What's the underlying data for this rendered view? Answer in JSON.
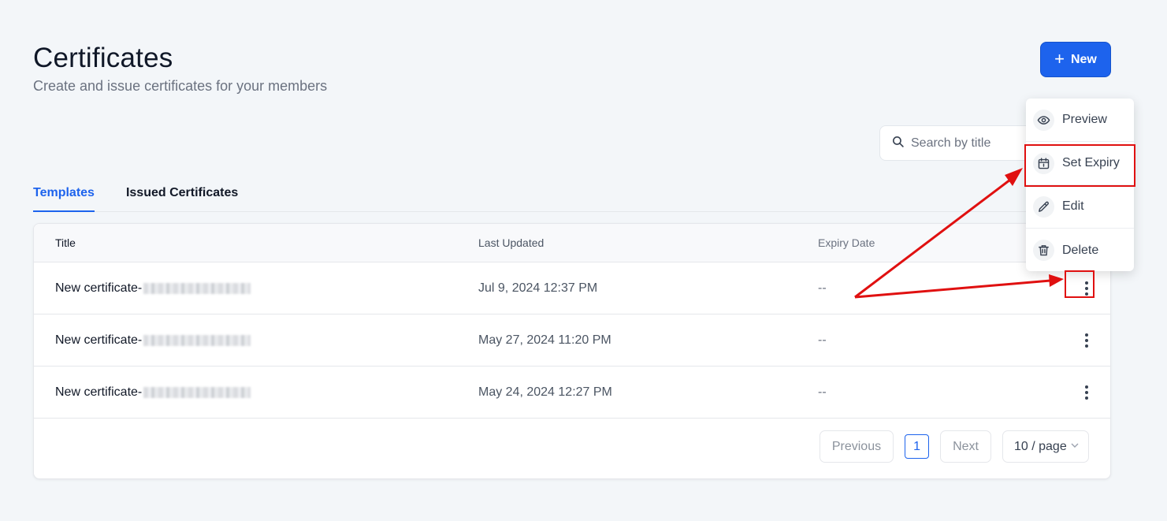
{
  "header": {
    "title": "Certificates",
    "subtitle": "Create and issue certificates for your members",
    "new_button_label": "New"
  },
  "search": {
    "placeholder": "Search by title"
  },
  "tabs": [
    {
      "label": "Templates",
      "active": true
    },
    {
      "label": "Issued Certificates",
      "active": false
    }
  ],
  "table": {
    "columns": [
      "Title",
      "Last Updated",
      "Expiry Date"
    ],
    "rows": [
      {
        "title": "New certificate-",
        "last_updated": "Jul 9, 2024 12:37 PM",
        "expiry": "--"
      },
      {
        "title": "New certificate-",
        "last_updated": "May 27, 2024 11:20 PM",
        "expiry": "--"
      },
      {
        "title": "New certificate-",
        "last_updated": "May 24, 2024 12:27 PM",
        "expiry": "--"
      }
    ]
  },
  "pagination": {
    "previous_label": "Previous",
    "current_page": "1",
    "next_label": "Next",
    "page_size": "10 / page"
  },
  "context_menu": {
    "items": [
      {
        "label": "Preview",
        "icon": "eye-icon"
      },
      {
        "label": "Set Expiry",
        "icon": "calendar-icon"
      },
      {
        "label": "Edit",
        "icon": "pencil-icon"
      },
      {
        "label": "Delete",
        "icon": "trash-icon"
      }
    ]
  },
  "colors": {
    "accent": "#1d63ed",
    "annotation": "#e01010",
    "background": "#f3f6f9"
  }
}
